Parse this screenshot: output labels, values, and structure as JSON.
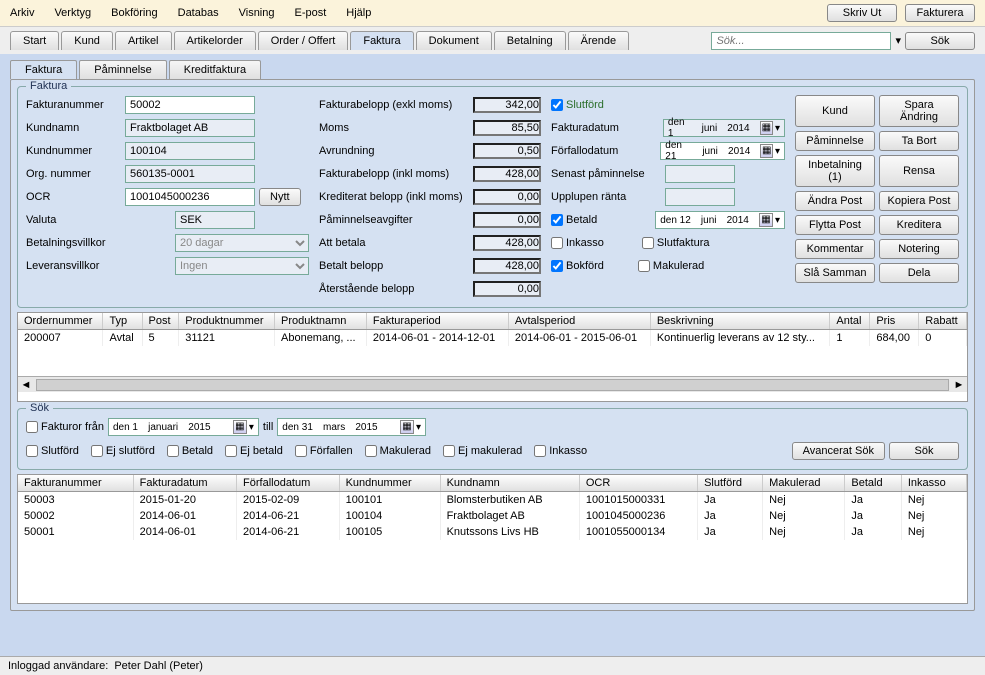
{
  "menu": {
    "items": [
      "Arkiv",
      "Verktyg",
      "Bokföring",
      "Databas",
      "Visning",
      "E-post",
      "Hjälp"
    ]
  },
  "topButtons": {
    "print": "Skriv Ut",
    "invoice": "Fakturera",
    "search": "Sök",
    "searchPlaceholder": "Sök..."
  },
  "mainTabs": [
    "Start",
    "Kund",
    "Artikel",
    "Artikelorder",
    "Order / Offert",
    "Faktura",
    "Dokument",
    "Betalning",
    "Ärende"
  ],
  "subTabs": [
    "Faktura",
    "Påminnelse",
    "Kreditfaktura"
  ],
  "group": {
    "title": "Faktura"
  },
  "fields": {
    "invoiceNo": {
      "label": "Fakturanummer",
      "value": "50002"
    },
    "custName": {
      "label": "Kundnamn",
      "value": "Fraktbolaget AB"
    },
    "custNo": {
      "label": "Kundnummer",
      "value": "100104"
    },
    "orgNo": {
      "label": "Org. nummer",
      "value": "560135-0001"
    },
    "ocr": {
      "label": "OCR",
      "value": "1001045000236",
      "new": "Nytt"
    },
    "currency": {
      "label": "Valuta",
      "value": "SEK"
    },
    "payTerms": {
      "label": "Betalningsvillkor",
      "value": "20 dagar"
    },
    "delivTerms": {
      "label": "Leveransvillkor",
      "value": "Ingen"
    }
  },
  "amounts": {
    "exVat": {
      "label": "Fakturabelopp (exkl moms)",
      "value": "342,00"
    },
    "vat": {
      "label": "Moms",
      "value": "85,50"
    },
    "round": {
      "label": "Avrundning",
      "value": "0,50"
    },
    "incVat": {
      "label": "Fakturabelopp (inkl moms)",
      "value": "428,00"
    },
    "credited": {
      "label": "Krediterat belopp (inkl moms)",
      "value": "0,00"
    },
    "remFee": {
      "label": "Påminnelseavgifter",
      "value": "0,00"
    },
    "toPay": {
      "label": "Att betala",
      "value": "428,00"
    },
    "paid": {
      "label": "Betalt belopp",
      "value": "428,00"
    },
    "remaining": {
      "label": "Återstående belopp",
      "value": "0,00"
    }
  },
  "flags": {
    "completed": {
      "label": "Slutförd",
      "checked": true
    },
    "invoiceDate": {
      "label": "Fakturadatum",
      "d": "den  1",
      "m": "juni",
      "y": "2014"
    },
    "dueDate": {
      "label": "Förfallodatum",
      "d": "den 21",
      "m": "juni",
      "y": "2014"
    },
    "lastReminder": {
      "label": "Senast påminnelse"
    },
    "accrued": {
      "label": "Upplupen ränta"
    },
    "paidFlag": {
      "label": "Betald",
      "checked": true,
      "d": "den 12",
      "m": "juni",
      "y": "2014"
    },
    "inkasso": {
      "label": "Inkasso",
      "checked": false
    },
    "final": {
      "label": "Slutfaktura",
      "checked": false
    },
    "posted": {
      "label": "Bokförd",
      "checked": true
    },
    "void": {
      "label": "Makulerad",
      "checked": false
    }
  },
  "actions": {
    "customer": "Kund",
    "save": "Spara Ändring",
    "reminder": "Påminnelse",
    "delete": "Ta Bort",
    "payment": "Inbetalning (1)",
    "clear": "Rensa",
    "edit": "Ändra Post",
    "copy": "Kopiera Post",
    "move": "Flytta Post",
    "credit": "Kreditera",
    "comment": "Kommentar",
    "note": "Notering",
    "merge": "Slå Samman",
    "split": "Dela"
  },
  "lineTable": {
    "headers": [
      "Ordernummer",
      "Typ",
      "Post",
      "Produktnummer",
      "Produktnamn",
      "Fakturaperiod",
      "Avtalsperiod",
      "Beskrivning",
      "Antal",
      "Pris",
      "Rabatt"
    ],
    "rows": [
      {
        "c": [
          "200007",
          "Avtal",
          "5",
          "31121",
          "Abonemang, ...",
          "2014-06-01 - 2014-12-01",
          "2014-06-01 - 2015-06-01",
          "Kontinuerlig leverans av 12 sty...",
          "1",
          "684,00",
          "0"
        ]
      }
    ]
  },
  "searchGroup": {
    "title": "Sök",
    "fromLabel": "Fakturor från",
    "from": {
      "d": "den  1",
      "m": "januari",
      "y": "2015"
    },
    "till": "till",
    "to": {
      "d": "den 31",
      "m": "mars",
      "y": "2015"
    },
    "filters": [
      "Slutförd",
      "Ej slutförd",
      "Betald",
      "Ej betald",
      "Förfallen",
      "Makulerad",
      "Ej makulerad",
      "Inkasso"
    ],
    "advanced": "Avancerat Sök",
    "search": "Sök"
  },
  "resultTable": {
    "headers": [
      "Fakturanummer",
      "Fakturadatum",
      "Förfallodatum",
      "Kundnummer",
      "Kundnamn",
      "OCR",
      "Slutförd",
      "Makulerad",
      "Betald",
      "Inkasso"
    ],
    "rows": [
      {
        "c": [
          "50003",
          "2015-01-20",
          "2015-02-09",
          "100101",
          "Blomsterbutiken AB",
          "1001015000331",
          "Ja",
          "Nej",
          "Ja",
          "Nej"
        ]
      },
      {
        "c": [
          "50002",
          "2014-06-01",
          "2014-06-21",
          "100104",
          "Fraktbolaget AB",
          "1001045000236",
          "Ja",
          "Nej",
          "Ja",
          "Nej"
        ]
      },
      {
        "c": [
          "50001",
          "2014-06-01",
          "2014-06-21",
          "100105",
          "Knutssons Livs HB",
          "1001055000134",
          "Ja",
          "Nej",
          "Ja",
          "Nej"
        ]
      }
    ]
  },
  "status": {
    "label": "Inloggad användare:",
    "value": "Peter Dahl (Peter)"
  }
}
